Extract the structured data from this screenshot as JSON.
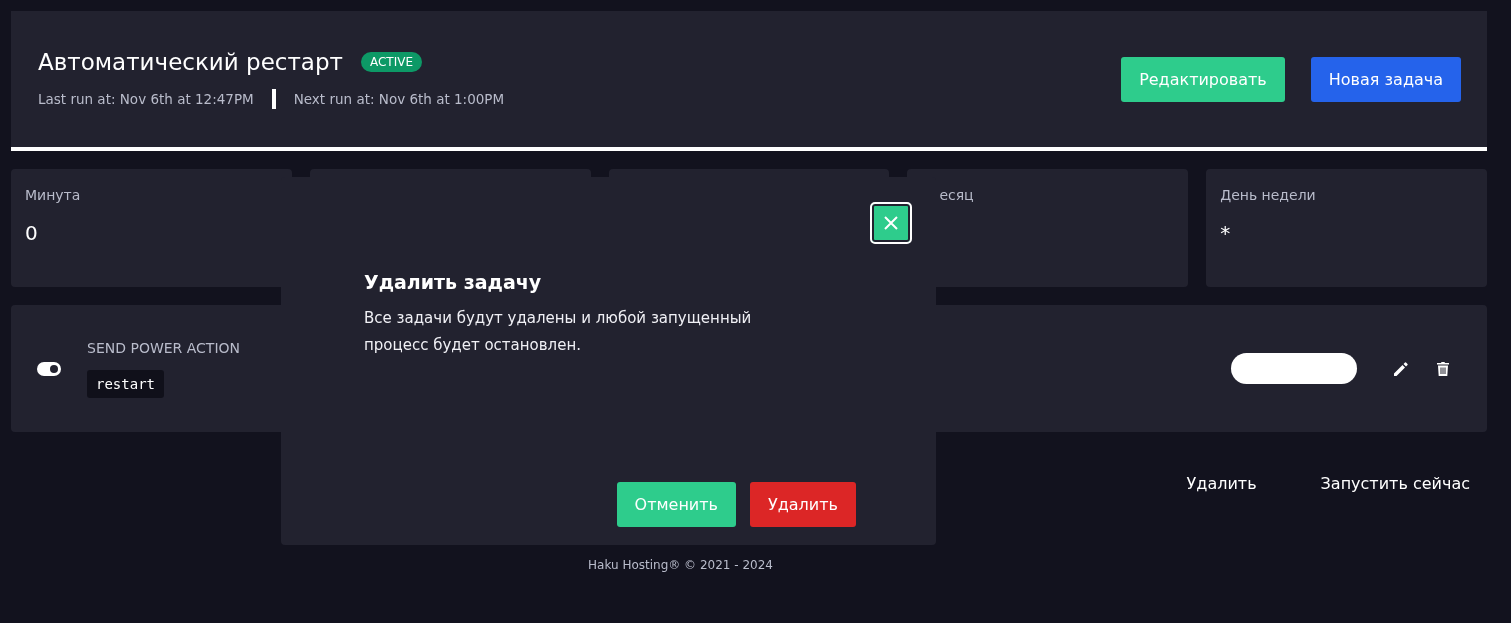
{
  "header": {
    "title": "Автоматический рестарт",
    "badge": "ACTIVE",
    "last_run": "Last run at: Nov 6th at 12:47PM",
    "next_run": "Next run at: Nov 6th at 1:00PM",
    "buttons": [
      {
        "label": "Редактировать",
        "kind": "success"
      },
      {
        "label": "Новая задача",
        "kind": "primary"
      }
    ]
  },
  "cron_cards": [
    {
      "kind": "shown",
      "label": "Минута",
      "value": "0"
    },
    {
      "kind": "hidden"
    },
    {
      "kind": "hidden"
    },
    {
      "kind": "covered",
      "label": "есяц"
    },
    {
      "kind": "shown",
      "label": "День недели",
      "value": "*"
    }
  ],
  "task": {
    "enabled": true,
    "action": "SEND POWER ACTION",
    "payload": "restart"
  },
  "actions": [
    "Удалить",
    "Запустить сейчас"
  ],
  "footer": "Haku Hosting® © 2021 - 2024",
  "modal": {
    "title": "Удалить задачу",
    "message": "Все задачи будут удалены и любой запущенный процесс будет остановлен.",
    "buttons": [
      {
        "label": "Отменить",
        "kind": "success"
      },
      {
        "label": "Удалить",
        "kind": "danger"
      }
    ]
  }
}
